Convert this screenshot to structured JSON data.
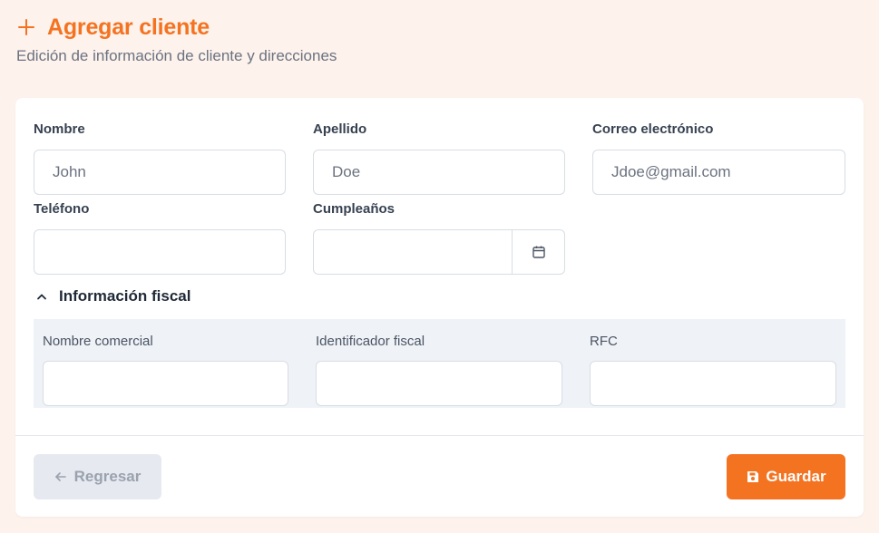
{
  "header": {
    "icon": "plus-icon",
    "title": "Agregar cliente",
    "subtitle": "Edición de información de cliente y direcciones"
  },
  "form": {
    "nombre": {
      "label": "Nombre",
      "placeholder": "John"
    },
    "apellido": {
      "label": "Apellido",
      "placeholder": "Doe"
    },
    "correo": {
      "label": "Correo electrónico",
      "placeholder": "Jdoe@gmail.com"
    },
    "telefono": {
      "label": "Teléfono",
      "value": ""
    },
    "cumpleanos": {
      "label": "Cumpleaños",
      "value": "",
      "icon": "calendar-icon"
    }
  },
  "fiscal": {
    "title": "Información fiscal",
    "expanded": true,
    "nombre_comercial": {
      "label": "Nombre comercial",
      "value": ""
    },
    "identificador": {
      "label": "Identificador fiscal",
      "value": ""
    },
    "rfc": {
      "label": "RFC",
      "value": ""
    }
  },
  "actions": {
    "back_label": "Regresar",
    "save_label": "Guardar"
  },
  "colors": {
    "accent": "#f47321",
    "background": "#fdf2ec",
    "panel": "#eff2f7"
  }
}
